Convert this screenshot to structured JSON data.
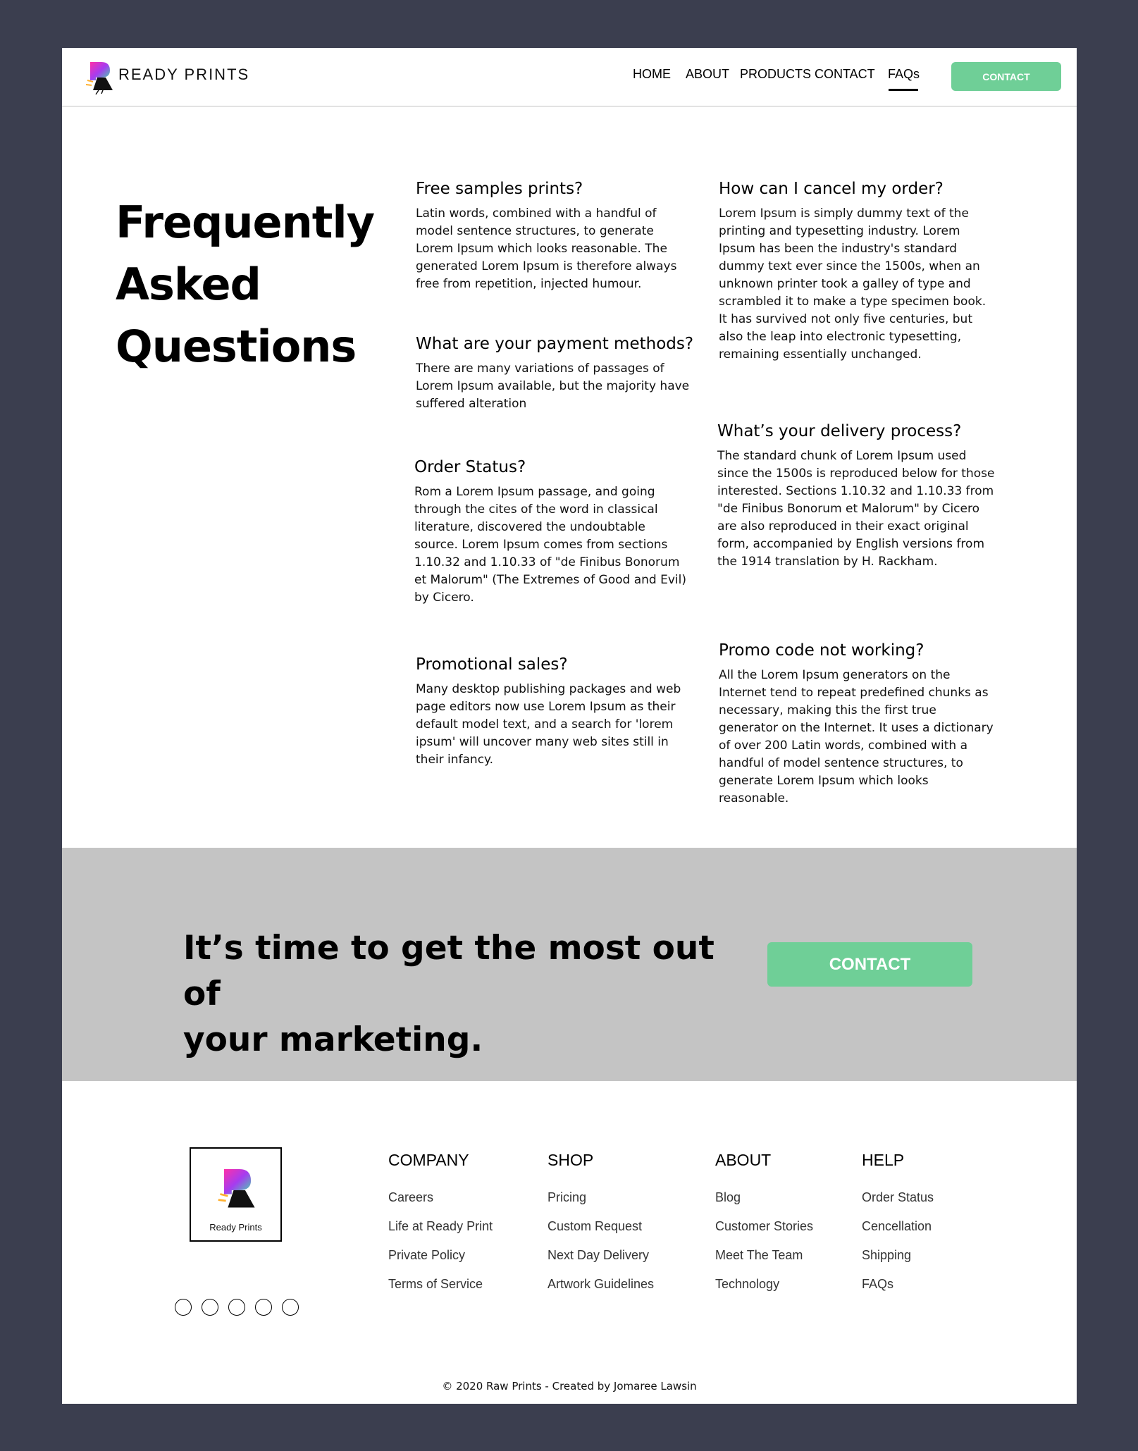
{
  "header": {
    "brand": "READY PRINTS",
    "nav": [
      "HOME",
      "ABOUT",
      "PRODUCTS",
      "CONTACT",
      "FAQs"
    ],
    "active_nav": "FAQs",
    "contact_button": "CONTACT"
  },
  "faq": {
    "title_line1": "Frequently",
    "title_line2": "Asked",
    "title_line3": "Questions",
    "items": [
      {
        "question": "Free samples prints?",
        "answer": "Latin words, combined with a handful of model sentence structures, to generate Lorem Ipsum which looks reasonable. The generated Lorem Ipsum is therefore always free from repetition, injected humour."
      },
      {
        "question": "What are your payment methods?",
        "answer": "There are many variations of passages of Lorem Ipsum available, but the majority have suffered alteration"
      },
      {
        "question": "Order Status?",
        "answer": "Rom a Lorem Ipsum passage, and going through the cites of the word in classical literature, discovered the undoubtable source. Lorem Ipsum comes from sections 1.10.32 and 1.10.33 of \"de Finibus Bonorum et Malorum\" (The Extremes of Good and Evil) by Cicero."
      },
      {
        "question": "Promotional sales?",
        "answer": "Many desktop publishing packages and web page editors now use Lorem Ipsum as their default model text, and a search for 'lorem ipsum' will uncover many web sites still in their infancy."
      },
      {
        "question": "How can I cancel my order?",
        "answer": "Lorem Ipsum is simply dummy text of the printing and typesetting industry. Lorem Ipsum has been the industry's standard dummy text ever since the 1500s, when an unknown printer took a galley of type and scrambled it to make a type specimen book. It has survived not only five centuries, but also the leap into electronic typesetting, remaining essentially unchanged."
      },
      {
        "question": "What’s your delivery process?",
        "answer": "The standard chunk of Lorem Ipsum used since the 1500s is reproduced below for those interested. Sections 1.10.32 and 1.10.33 from \"de Finibus Bonorum et Malorum\" by Cicero are also reproduced in their exact original form, accompanied by English versions from the 1914 translation by H. Rackham."
      },
      {
        "question": "Promo code not working?",
        "answer": "All the Lorem Ipsum generators on the Internet tend to repeat predefined chunks as necessary, making this the first true generator on the Internet. It uses a dictionary of over 200 Latin words, combined with a handful of model sentence structures, to generate Lorem Ipsum which looks reasonable."
      }
    ]
  },
  "cta": {
    "line1": "It’s time to get the most out of",
    "line2": "your marketing.",
    "button": "CONTACT"
  },
  "footer": {
    "logo_label": "Ready Prints",
    "social_icons": [
      "social-icon-1",
      "social-icon-2",
      "social-icon-3",
      "social-icon-4",
      "social-icon-5"
    ],
    "columns": [
      {
        "heading": "COMPANY",
        "links": [
          "Careers",
          "Life at Ready Print",
          "Private Policy",
          "Terms of Service"
        ]
      },
      {
        "heading": "SHOP",
        "links": [
          "Pricing",
          "Custom Request",
          "Next Day Delivery",
          "Artwork Guidelines"
        ]
      },
      {
        "heading": "ABOUT",
        "links": [
          "Blog",
          "Customer Stories",
          "Meet The Team",
          "Technology"
        ]
      },
      {
        "heading": "HELP",
        "links": [
          "Order Status",
          "Cencellation",
          "Shipping",
          "FAQs"
        ]
      }
    ],
    "copyright": "© 2020 Raw Prints - Created by Jomaree Lawsin"
  },
  "colors": {
    "background": "#3b3e4f",
    "accent_green": "#6fcf97",
    "cta_band": "#c4c4c4"
  }
}
